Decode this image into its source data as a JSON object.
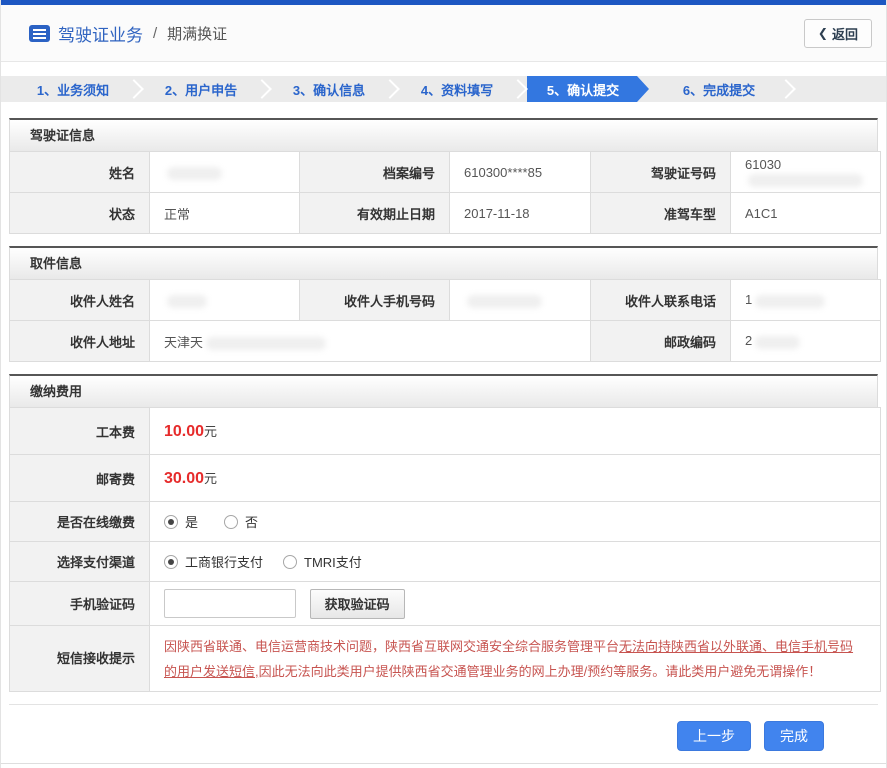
{
  "header": {
    "title": "驾驶证业务",
    "separator": "/",
    "subtitle": "期满换证",
    "back_chevron": "❮",
    "back_label": "返回"
  },
  "steps": [
    {
      "label": "1、业务须知",
      "active": false
    },
    {
      "label": "2、用户申告",
      "active": false
    },
    {
      "label": "3、确认信息",
      "active": false
    },
    {
      "label": "4、资料填写",
      "active": false
    },
    {
      "label": "5、确认提交",
      "active": true
    },
    {
      "label": "6、完成提交",
      "active": false
    }
  ],
  "license_info": {
    "title": "驾驶证信息",
    "fields": {
      "name": {
        "label": "姓名",
        "value": ""
      },
      "file_no": {
        "label": "档案编号",
        "value": "610300****85"
      },
      "license_no": {
        "label": "驾驶证号码",
        "value": "61030"
      },
      "status": {
        "label": "状态",
        "value": "正常"
      },
      "valid_until": {
        "label": "有效期止日期",
        "value": "2017-11-18"
      },
      "vehicle_class": {
        "label": "准驾车型",
        "value": "A1C1"
      }
    }
  },
  "pickup_info": {
    "title": "取件信息",
    "fields": {
      "recipient_name": {
        "label": "收件人姓名",
        "value": ""
      },
      "recipient_mobile": {
        "label": "收件人手机号码",
        "value": ""
      },
      "recipient_phone": {
        "label": "收件人联系电话",
        "value": "1"
      },
      "recipient_address": {
        "label": "收件人地址",
        "value": "天津天"
      },
      "postal_code": {
        "label": "邮政编码",
        "value": "2"
      }
    }
  },
  "payment": {
    "title": "缴纳费用",
    "fee_label": "工本费",
    "fee_amount": "10.00",
    "fee_unit": "元",
    "postage_label": "邮寄费",
    "postage_amount": "30.00",
    "postage_unit": "元",
    "online_label": "是否在线缴费",
    "online_yes": "是",
    "online_no": "否",
    "online_selected": "是",
    "channel_label": "选择支付渠道",
    "channel_icbc": "工商银行支付",
    "channel_tmri": "TMRI支付",
    "channel_selected": "工商银行支付",
    "sms_label": "手机验证码",
    "sms_input_value": "",
    "sms_button": "获取验证码",
    "notice_label": "短信接收提示",
    "notice_part1": "因陕西省联通、电信运营商技术问题，陕西省互联网交通安全综合服务管理平台",
    "notice_underlined": "无法向持陕西省以外联通、电信手机号码的用户发送短信,",
    "notice_part2": "因此无法向此类用户提供陕西省交通管理业务的网上办理/预约等服务。请此类用户避免无谓操作！"
  },
  "footer": {
    "prev_label": "上一步",
    "done_label": "完成"
  },
  "colors": {
    "top_accent": "#1d57c2",
    "title_blue": "#2f63c0",
    "step_active_blue": "#3377e0",
    "button_blue": "#4184ee",
    "amount_red": "#e62b2b",
    "notice_red": "#c75450"
  }
}
